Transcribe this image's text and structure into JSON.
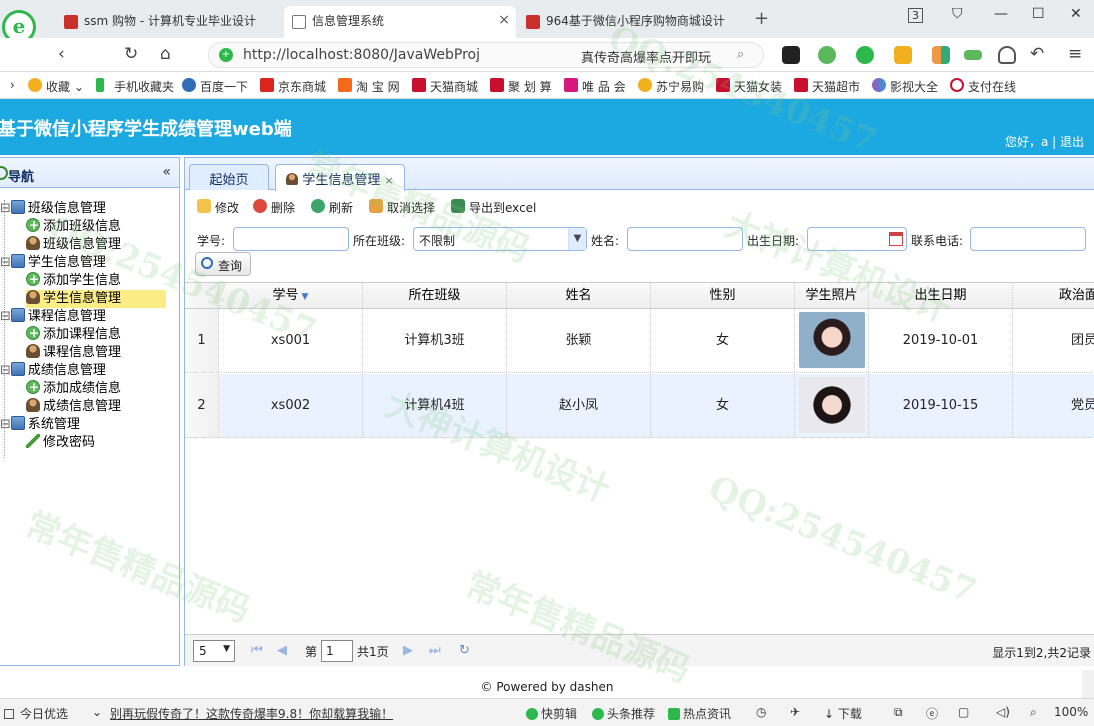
{
  "browser": {
    "tabs": [
      {
        "label": "ssm 购物 - 计算机专业毕业设计"
      },
      {
        "label": "信息管理系统"
      },
      {
        "label": "964基于微信小程序购物商城设计"
      }
    ],
    "tab_count": "3",
    "url": "http://localhost:8080/JavaWebProj",
    "search_hint": "真传奇高爆率点开即玩"
  },
  "bookmarks": [
    {
      "label": "收藏"
    },
    {
      "label": "手机收藏夹"
    },
    {
      "label": "百度一下"
    },
    {
      "label": "京东商城"
    },
    {
      "label": "淘 宝 网"
    },
    {
      "label": "天猫商城"
    },
    {
      "label": "聚 划 算"
    },
    {
      "label": "唯 品 会"
    },
    {
      "label": "苏宁易购"
    },
    {
      "label": "天猫女装"
    },
    {
      "label": "天猫超市"
    },
    {
      "label": "影视大全"
    },
    {
      "label": "支付在线"
    }
  ],
  "app": {
    "title": "基于微信小程序学生成绩管理web端",
    "user_text": "您好，a | 退出"
  },
  "sidebar": {
    "title": "导航",
    "groups": [
      {
        "label": "班级信息管理",
        "items": [
          {
            "label": "添加班级信息"
          },
          {
            "label": "班级信息管理"
          }
        ]
      },
      {
        "label": "学生信息管理",
        "items": [
          {
            "label": "添加学生信息"
          },
          {
            "label": "学生信息管理"
          }
        ]
      },
      {
        "label": "课程信息管理",
        "items": [
          {
            "label": "添加课程信息"
          },
          {
            "label": "课程信息管理"
          }
        ]
      },
      {
        "label": "成绩信息管理",
        "items": [
          {
            "label": "添加成绩信息"
          },
          {
            "label": "成绩信息管理"
          }
        ]
      },
      {
        "label": "系统管理",
        "items": [
          {
            "label": "修改密码"
          }
        ]
      }
    ]
  },
  "main": {
    "tabs": [
      {
        "label": "起始页"
      },
      {
        "label": "学生信息管理"
      }
    ],
    "toolbar": {
      "edit": "修改",
      "delete": "删除",
      "refresh": "刷新",
      "cancel_select": "取消选择",
      "export": "导出到excel"
    },
    "search": {
      "xh_label": "学号:",
      "class_label": "所在班级:",
      "class_value": "不限制",
      "name_label": "姓名:",
      "birth_label": "出生日期:",
      "phone_label": "联系电话:",
      "query_label": "查询"
    },
    "table": {
      "headers": [
        "学号",
        "所在班级",
        "姓名",
        "性别",
        "学生照片",
        "出生日期",
        "政治面"
      ],
      "rows": [
        {
          "num": "1",
          "xh": "xs001",
          "class": "计算机3班",
          "name": "张颖",
          "gender": "女",
          "birth": "2019-10-01",
          "politics": "团员"
        },
        {
          "num": "2",
          "xh": "xs002",
          "class": "计算机4班",
          "name": "赵小凤",
          "gender": "女",
          "birth": "2019-10-15",
          "politics": "党员"
        }
      ]
    },
    "pager": {
      "page_size": "5",
      "page_prefix": "第",
      "page_value": "1",
      "page_total": "共1页",
      "info": "显示1到2,共2记录"
    }
  },
  "footer": "© Powered by dashen",
  "statusbar": {
    "today": "今日优选",
    "news": "别再玩假传奇了！这款传奇爆率9.8！你却载算我输！",
    "quick_edit": "快剪辑",
    "headlines": "头条推荐",
    "hot": "热点资讯",
    "download": "下载",
    "zoom": "100%"
  },
  "watermarks": [
    "QQ:254540457",
    "常年售精品源码",
    "大神计算机设计"
  ]
}
